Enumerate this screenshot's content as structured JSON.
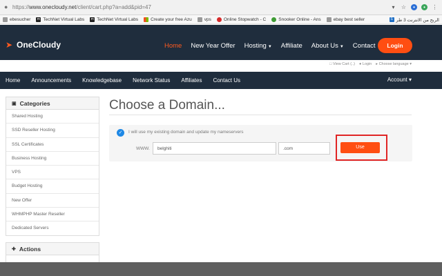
{
  "browser": {
    "url_prefix": "https://",
    "url_host": "www.onecloudy.net",
    "url_path": "/client/cart.php?a=add&pid=47"
  },
  "bookmarks": [
    {
      "icon": "gray-icon",
      "label": "ebesucher"
    },
    {
      "icon": "technet-icon",
      "label": "TechNet Virtual Labs"
    },
    {
      "icon": "technet-icon",
      "label": "TechNet Virtual Labs"
    },
    {
      "icon": "microsoft-icon",
      "label": "Create your free Azu"
    },
    {
      "icon": "tnn-icon",
      "label": "vps"
    },
    {
      "icon": "stopwatch-icon",
      "label": "Online Stopwatch - C"
    },
    {
      "icon": "snooker-icon",
      "label": "Snooker Online - Ans"
    },
    {
      "icon": "page-icon",
      "label": "ebay best seller"
    }
  ],
  "bookmarks_right": "الربح من الانترنت 3 طر",
  "site": {
    "logo": "OneCloudy",
    "nav": [
      {
        "label": "Home",
        "active": true,
        "caret": false
      },
      {
        "label": "New Year Offer",
        "active": false,
        "caret": false
      },
      {
        "label": "Hosting",
        "active": false,
        "caret": true
      },
      {
        "label": "Affiliate",
        "active": false,
        "caret": false
      },
      {
        "label": "About Us",
        "active": false,
        "caret": true
      },
      {
        "label": "Contact",
        "active": false,
        "caret": false
      }
    ],
    "login_label": "Login",
    "util": {
      "cart": "View Cart (..)",
      "login": "Login",
      "language": "Choose language"
    },
    "subnav": [
      "Home",
      "Announcements",
      "Knowledgebase",
      "Network Status",
      "Affiliates",
      "Contact Us"
    ],
    "account": "Account"
  },
  "sidebar": {
    "categories_title": "Categories",
    "items": [
      "Shared Hosting",
      "SSD Reseller Hosting",
      "SSL Certificates",
      "Business Hosting",
      "VPS",
      "Budget Hosting",
      "New Offer",
      "WHMPHP Master Reseller",
      "Dedicated Servers"
    ],
    "actions_title": "Actions"
  },
  "main": {
    "title": "Choose a Domain...",
    "option_label": "I will use my existing domain and update my nameservers",
    "www_label": "WWW.",
    "sld_value": "belghiti",
    "tld_value": ".com",
    "use_label": "Use"
  },
  "colors": {
    "navy": "#1f2d3d",
    "accent": "#ff4e12",
    "highlight": "#e02424"
  }
}
